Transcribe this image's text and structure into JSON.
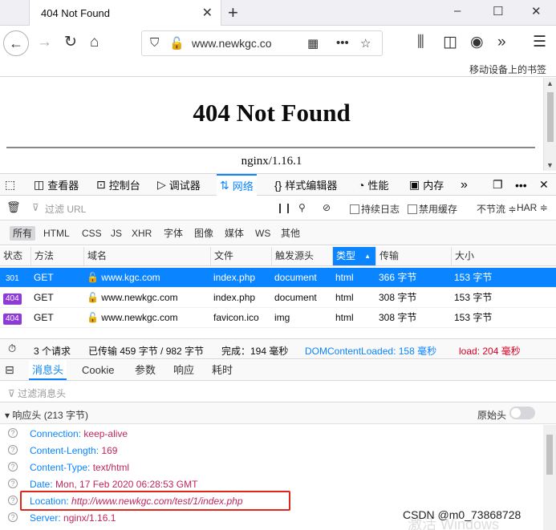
{
  "browser": {
    "tab_title": "404 Not Found",
    "tab_close": "✕",
    "new_tab": "+",
    "url": "www.newkgc.co",
    "bookmarks_mobile": "移动设备上的书签"
  },
  "page": {
    "heading": "404 Not Found",
    "server": "nginx/1.16.1"
  },
  "devtools": {
    "tabs": [
      {
        "icon": "◫",
        "label": "查看器"
      },
      {
        "icon": "⊡",
        "label": "控制台"
      },
      {
        "icon": "▷",
        "label": "调试器"
      },
      {
        "icon": "⇅",
        "label": "网络"
      },
      {
        "icon": "{}",
        "label": "样式编辑器"
      },
      {
        "icon": "◔",
        "label": "性能"
      },
      {
        "icon": "▣",
        "label": "内存"
      }
    ],
    "more": "»",
    "filter_placeholder": "过滤 URL",
    "persist_log": "持续日志",
    "disable_cache": "禁用缓存",
    "throttle": "不节流 ≑",
    "har": "HAR ≑",
    "type_filters": [
      "所有",
      "HTML",
      "CSS",
      "JS",
      "XHR",
      "字体",
      "图像",
      "媒体",
      "WS",
      "其他"
    ],
    "columns": [
      "状态",
      "方法",
      "域名",
      "文件",
      "触发源头",
      "类型",
      "传输",
      "大小"
    ],
    "rows": [
      {
        "status": "301",
        "method": "GET",
        "domain": "www.kgc.com",
        "file": "index.php",
        "cause": "document",
        "type": "html",
        "transferred": "366 字节",
        "size": "153 字节"
      },
      {
        "status": "404",
        "method": "GET",
        "domain": "www.newkgc.com",
        "file": "index.php",
        "cause": "document",
        "type": "html",
        "transferred": "308 字节",
        "size": "153 字节"
      },
      {
        "status": "404",
        "method": "GET",
        "domain": "www.newkgc.com",
        "file": "favicon.ico",
        "cause": "img",
        "type": "html",
        "transferred": "308 字节",
        "size": "153 字节"
      }
    ],
    "summary": {
      "requests": "3 个请求",
      "transferred": "已传输 459 字节 / 982 字节",
      "finish": "完成：194 毫秒",
      "dom": "DOMContentLoaded: 158 毫秒",
      "load": "load: 204 毫秒"
    },
    "detail_tabs": [
      "消息头",
      "Cookie",
      "参数",
      "响应",
      "耗时"
    ],
    "header_filter_placeholder": "过滤消息头",
    "response_headers_title": "响应头 (213 字节)",
    "raw_headers": "原始头",
    "headers": [
      {
        "key": "Connection:",
        "value": "keep-alive"
      },
      {
        "key": "Content-Length:",
        "value": "169"
      },
      {
        "key": "Content-Type:",
        "value": "text/html"
      },
      {
        "key": "Date:",
        "value": "Mon, 17 Feb 2020 06:28:53 GMT"
      },
      {
        "key": "Location:",
        "value": "http://www.newkgc.com/test/1/index.php"
      },
      {
        "key": "Server:",
        "value": "nginx/1.16.1"
      }
    ]
  },
  "watermark": "CSDN @m0_73868728",
  "activation_mark": "激活 Windows",
  "colors": {
    "accent": "#0a84ff",
    "status_301": "#0a84ff",
    "status_404": "#8e3ad6",
    "highlight_box": "#e1251b"
  }
}
